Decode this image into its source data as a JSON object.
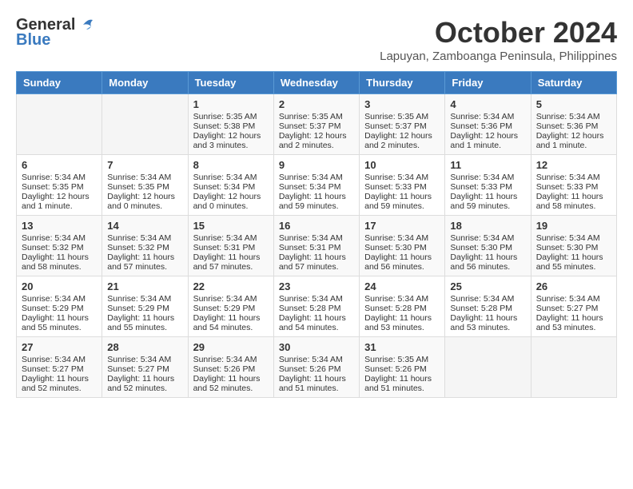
{
  "header": {
    "logo_general": "General",
    "logo_blue": "Blue",
    "month": "October 2024",
    "location": "Lapuyan, Zamboanga Peninsula, Philippines"
  },
  "days_of_week": [
    "Sunday",
    "Monday",
    "Tuesday",
    "Wednesday",
    "Thursday",
    "Friday",
    "Saturday"
  ],
  "weeks": [
    [
      {
        "day": "",
        "info": ""
      },
      {
        "day": "",
        "info": ""
      },
      {
        "day": "1",
        "info": "Sunrise: 5:35 AM\nSunset: 5:38 PM\nDaylight: 12 hours and 3 minutes."
      },
      {
        "day": "2",
        "info": "Sunrise: 5:35 AM\nSunset: 5:37 PM\nDaylight: 12 hours and 2 minutes."
      },
      {
        "day": "3",
        "info": "Sunrise: 5:35 AM\nSunset: 5:37 PM\nDaylight: 12 hours and 2 minutes."
      },
      {
        "day": "4",
        "info": "Sunrise: 5:34 AM\nSunset: 5:36 PM\nDaylight: 12 hours and 1 minute."
      },
      {
        "day": "5",
        "info": "Sunrise: 5:34 AM\nSunset: 5:36 PM\nDaylight: 12 hours and 1 minute."
      }
    ],
    [
      {
        "day": "6",
        "info": "Sunrise: 5:34 AM\nSunset: 5:35 PM\nDaylight: 12 hours and 1 minute."
      },
      {
        "day": "7",
        "info": "Sunrise: 5:34 AM\nSunset: 5:35 PM\nDaylight: 12 hours and 0 minutes."
      },
      {
        "day": "8",
        "info": "Sunrise: 5:34 AM\nSunset: 5:34 PM\nDaylight: 12 hours and 0 minutes."
      },
      {
        "day": "9",
        "info": "Sunrise: 5:34 AM\nSunset: 5:34 PM\nDaylight: 11 hours and 59 minutes."
      },
      {
        "day": "10",
        "info": "Sunrise: 5:34 AM\nSunset: 5:33 PM\nDaylight: 11 hours and 59 minutes."
      },
      {
        "day": "11",
        "info": "Sunrise: 5:34 AM\nSunset: 5:33 PM\nDaylight: 11 hours and 59 minutes."
      },
      {
        "day": "12",
        "info": "Sunrise: 5:34 AM\nSunset: 5:33 PM\nDaylight: 11 hours and 58 minutes."
      }
    ],
    [
      {
        "day": "13",
        "info": "Sunrise: 5:34 AM\nSunset: 5:32 PM\nDaylight: 11 hours and 58 minutes."
      },
      {
        "day": "14",
        "info": "Sunrise: 5:34 AM\nSunset: 5:32 PM\nDaylight: 11 hours and 57 minutes."
      },
      {
        "day": "15",
        "info": "Sunrise: 5:34 AM\nSunset: 5:31 PM\nDaylight: 11 hours and 57 minutes."
      },
      {
        "day": "16",
        "info": "Sunrise: 5:34 AM\nSunset: 5:31 PM\nDaylight: 11 hours and 57 minutes."
      },
      {
        "day": "17",
        "info": "Sunrise: 5:34 AM\nSunset: 5:30 PM\nDaylight: 11 hours and 56 minutes."
      },
      {
        "day": "18",
        "info": "Sunrise: 5:34 AM\nSunset: 5:30 PM\nDaylight: 11 hours and 56 minutes."
      },
      {
        "day": "19",
        "info": "Sunrise: 5:34 AM\nSunset: 5:30 PM\nDaylight: 11 hours and 55 minutes."
      }
    ],
    [
      {
        "day": "20",
        "info": "Sunrise: 5:34 AM\nSunset: 5:29 PM\nDaylight: 11 hours and 55 minutes."
      },
      {
        "day": "21",
        "info": "Sunrise: 5:34 AM\nSunset: 5:29 PM\nDaylight: 11 hours and 55 minutes."
      },
      {
        "day": "22",
        "info": "Sunrise: 5:34 AM\nSunset: 5:29 PM\nDaylight: 11 hours and 54 minutes."
      },
      {
        "day": "23",
        "info": "Sunrise: 5:34 AM\nSunset: 5:28 PM\nDaylight: 11 hours and 54 minutes."
      },
      {
        "day": "24",
        "info": "Sunrise: 5:34 AM\nSunset: 5:28 PM\nDaylight: 11 hours and 53 minutes."
      },
      {
        "day": "25",
        "info": "Sunrise: 5:34 AM\nSunset: 5:28 PM\nDaylight: 11 hours and 53 minutes."
      },
      {
        "day": "26",
        "info": "Sunrise: 5:34 AM\nSunset: 5:27 PM\nDaylight: 11 hours and 53 minutes."
      }
    ],
    [
      {
        "day": "27",
        "info": "Sunrise: 5:34 AM\nSunset: 5:27 PM\nDaylight: 11 hours and 52 minutes."
      },
      {
        "day": "28",
        "info": "Sunrise: 5:34 AM\nSunset: 5:27 PM\nDaylight: 11 hours and 52 minutes."
      },
      {
        "day": "29",
        "info": "Sunrise: 5:34 AM\nSunset: 5:26 PM\nDaylight: 11 hours and 52 minutes."
      },
      {
        "day": "30",
        "info": "Sunrise: 5:34 AM\nSunset: 5:26 PM\nDaylight: 11 hours and 51 minutes."
      },
      {
        "day": "31",
        "info": "Sunrise: 5:35 AM\nSunset: 5:26 PM\nDaylight: 11 hours and 51 minutes."
      },
      {
        "day": "",
        "info": ""
      },
      {
        "day": "",
        "info": ""
      }
    ]
  ]
}
